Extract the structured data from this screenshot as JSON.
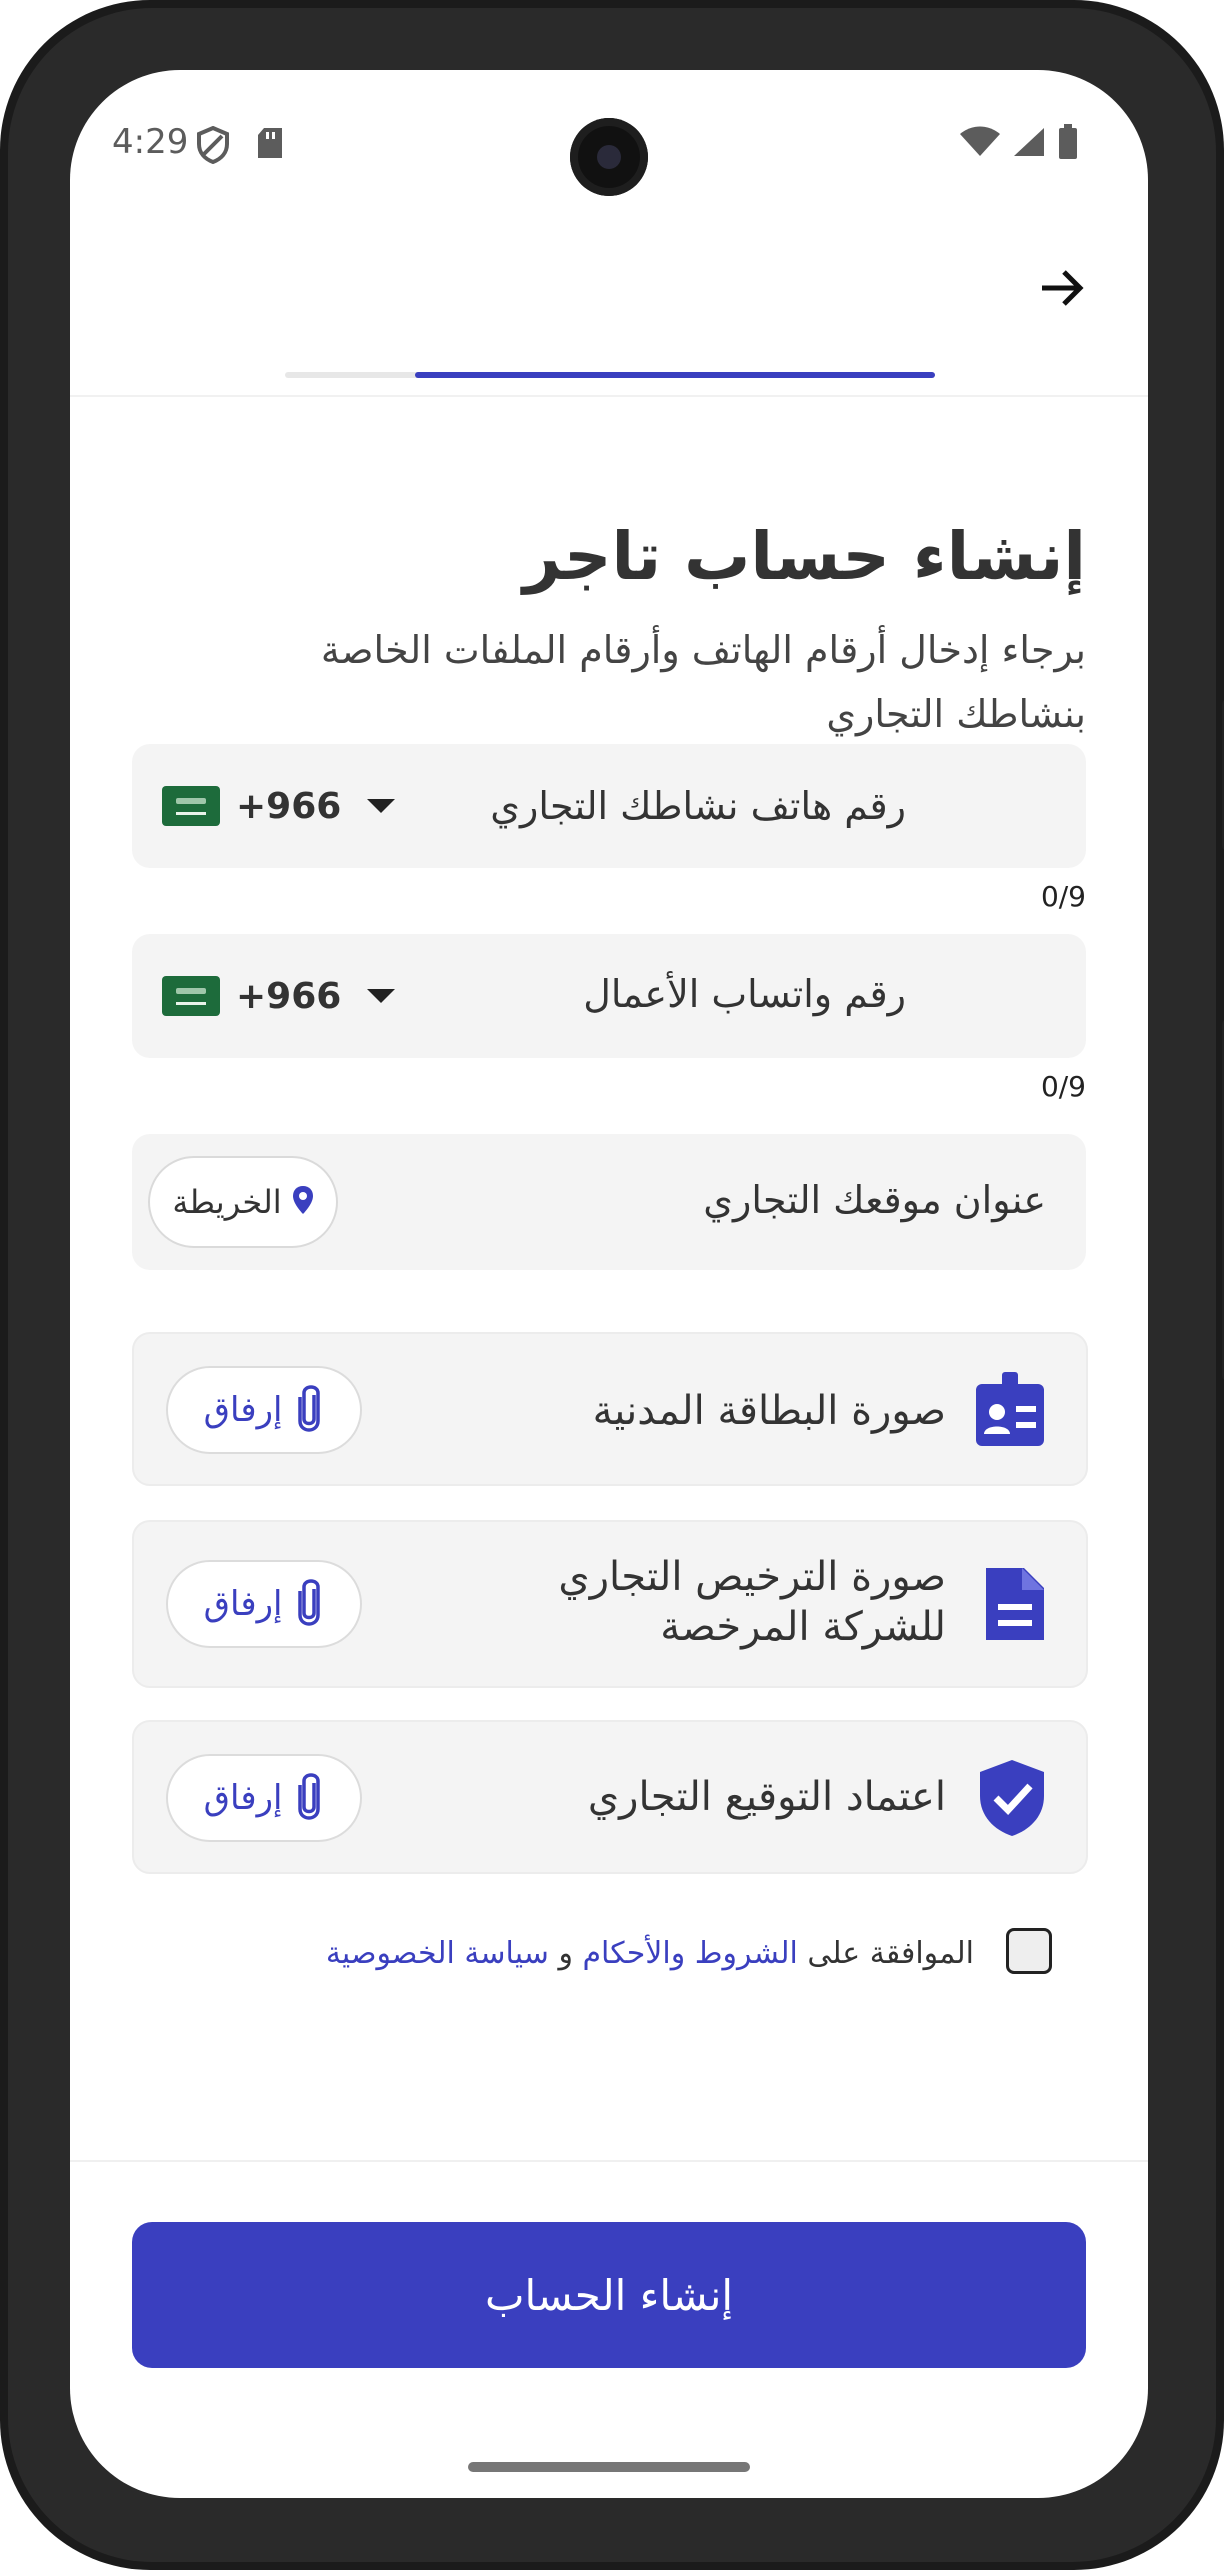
{
  "status_bar": {
    "time": "4:29",
    "icons_left": [
      "shield-icon",
      "sd-card-icon"
    ],
    "icons_right": [
      "wifi-icon",
      "signal-icon",
      "battery-icon"
    ]
  },
  "header": {
    "back_icon": "arrow-right-icon",
    "progress_fraction": 0.8
  },
  "title": "إنشاء حساب تاجر",
  "subtitle": "برجاء إدخال أرقام الهاتف وأرقام الملفات الخاصة بنشاطك التجاري",
  "fields": {
    "business_phone": {
      "label": "رقم هاتف نشاطك التجاري",
      "dial_code": "+966",
      "counter": "0/9"
    },
    "whatsapp": {
      "label": "رقم واتساب الأعمال",
      "dial_code": "+966",
      "counter": "0/9"
    },
    "location": {
      "label": "عنوان موقعك التجاري",
      "map_button": "الخريطة"
    }
  },
  "documents": [
    {
      "label": "صورة البطاقة المدنية",
      "icon": "id-card-icon",
      "button": "إرفاق"
    },
    {
      "label": "صورة الترخيص التجاري للشركة المرخصة",
      "icon": "document-icon",
      "button": "إرفاق"
    },
    {
      "label": "اعتماد التوقيع التجاري",
      "icon": "verified-shield-icon",
      "button": "إرفاق"
    }
  ],
  "terms": {
    "prefix": "الموافقة على",
    "terms_link": "الشروط والأحكام",
    "and": "و",
    "privacy_link": "سياسة الخصوصية",
    "checked": false
  },
  "submit_label": "إنشاء الحساب",
  "colors": {
    "accent": "#3a3fbf",
    "field_bg": "#f4f4f4"
  }
}
